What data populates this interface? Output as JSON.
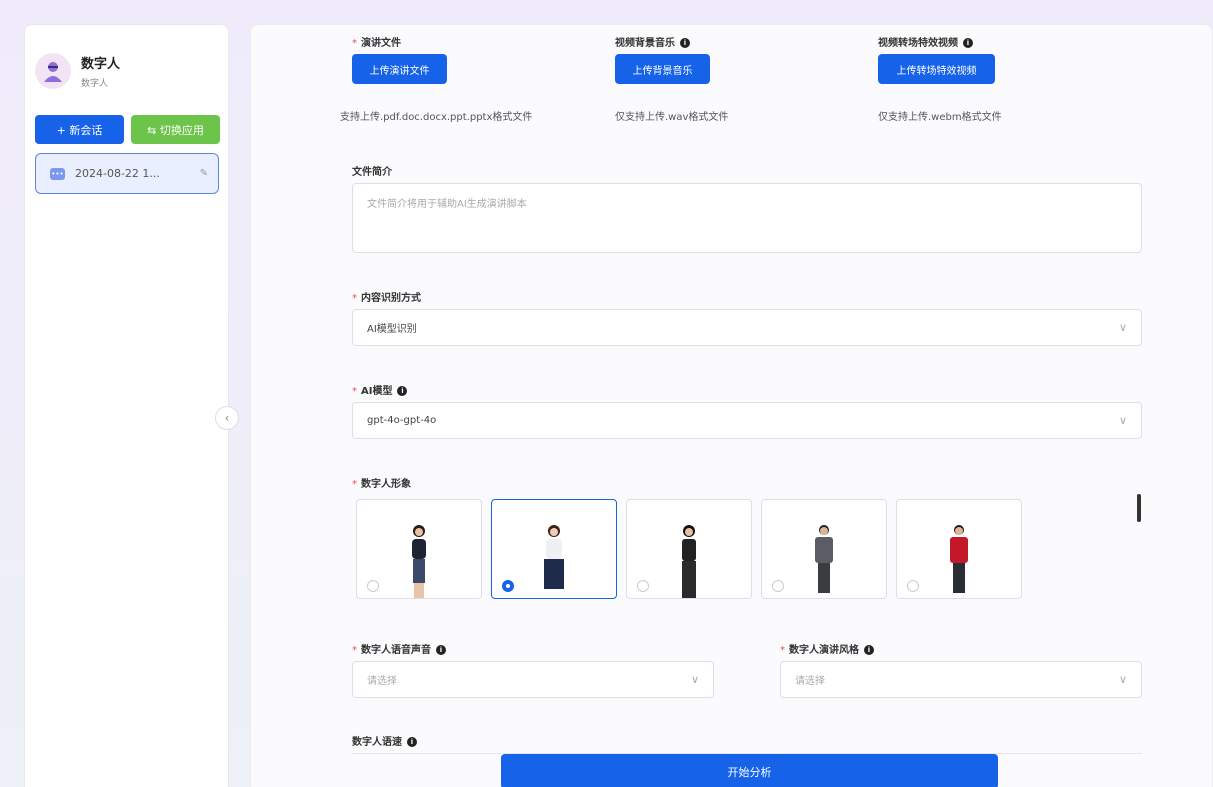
{
  "sidebar": {
    "brand_name": "数字人",
    "brand_sub": "数字人",
    "new_chat": "+ 新会话",
    "switch_app": "⇆ 切换应用",
    "session_title": "2024-08-22 1..."
  },
  "form": {
    "speech_file_label": "演讲文件",
    "speech_file_button": "上传演讲文件",
    "speech_file_hint": "支持上传.pdf.doc.docx.ppt.pptx格式文件",
    "bgm_label": "视频背景音乐",
    "bgm_button": "上传背景音乐",
    "bgm_hint": "仅支持上传.wav格式文件",
    "transition_label": "视频转场特效视频",
    "transition_button": "上传转场特效视频",
    "transition_hint": "仅支持上传.webm格式文件",
    "intro_label": "文件简介",
    "intro_placeholder": "文件简介将用于辅助AI生成演讲脚本",
    "recognition_label": "内容识别方式",
    "recognition_value": "AI模型识别",
    "model_label": "AI模型",
    "model_value": "gpt-4o-gpt-4o",
    "avatar_label": "数字人形象",
    "selected_avatar_index": 1,
    "voice_label": "数字人语音声音",
    "voice_placeholder": "请选择",
    "style_label": "数字人演讲风格",
    "style_placeholder": "请选择",
    "speed_label": "数字人语速",
    "start_button": "开始分析"
  },
  "colors": {
    "primary": "#1662e9",
    "success": "#6cc44a",
    "required": "#e5504b"
  }
}
